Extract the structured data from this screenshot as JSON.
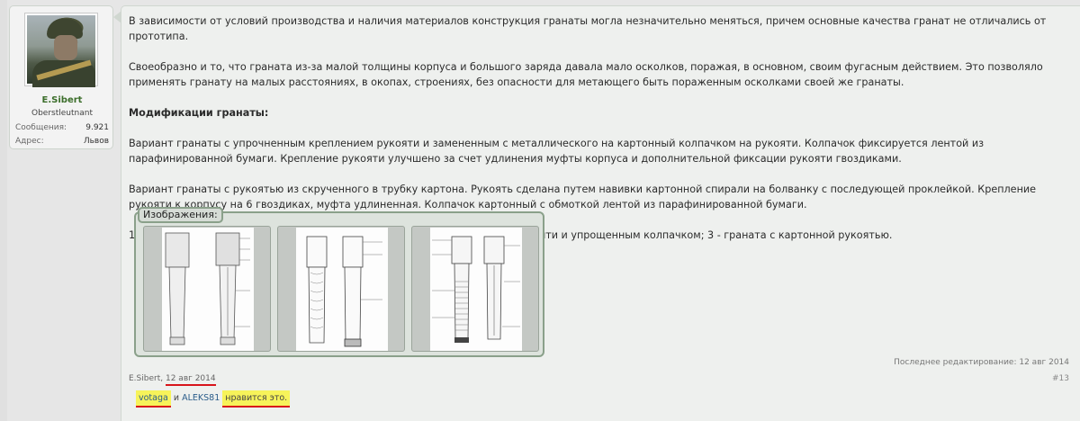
{
  "user": {
    "name": "E.Sibert",
    "rank": "Oberstleutnant",
    "messages_label": "Сообщения:",
    "messages_value": "9.921",
    "address_label": "Адрес:",
    "address_value": "Львов"
  },
  "post": {
    "paragraphs": [
      "В зависимости от условий производства и наличия материалов конструкция гранаты могла незначительно меняться, причем основные качества гранат не отличались от прототипа.",
      "Своеобразно и то, что граната из-за малой толщины корпуса и большого заряда давала мало осколков, поражая, в основном, своим фугасным действием. Это позволяло применять гранату на малых расстояниях, в окопах, строениях, без опасности для метающего быть пораженным осколками своей же гранаты."
    ],
    "heading": "Модификации гранаты:",
    "paragraphs2": [
      "Вариант гранаты с упрочненным креплением рукояти и замененным с металлического на картонный колпачком на рукояти. Колпачок фиксируется лентой из парафинированной бумаги. Крепление рукояти улучшено за счет удлинения муфты корпуса и дополнительной фиксации рукояти гвоздиками.",
      "Вариант гранаты с рукоятью из скрученного в трубку картона. Рукоять сделана путем навивки картонной спирали на болванку с последующей проклейкой. Крепление рукояти к корпусу на 6 гвоздиках, муфта удлиненная. Колпачок картонный с обмоткой лентой из парафинированной бумаги.",
      "1 - Stielhandgrate, основной тип; 2 - граната с улучшенным креплением рукояти и упрощенным колпачком; 3 - граната с картонной рукоятью."
    ],
    "attachments_label": "Изображения:",
    "edited": "Последнее редактирование: 12 авг 2014",
    "author": "E.Sibert",
    "date": "12 авг 2014",
    "post_number": "#13"
  },
  "likes": {
    "user1": "votaga",
    "and": "и",
    "user2": "ALEKS81",
    "text": "нравится это."
  },
  "colors": {
    "username": "#3c6e2b",
    "underline": "#d8141a",
    "highlight": "#f7f35a"
  }
}
